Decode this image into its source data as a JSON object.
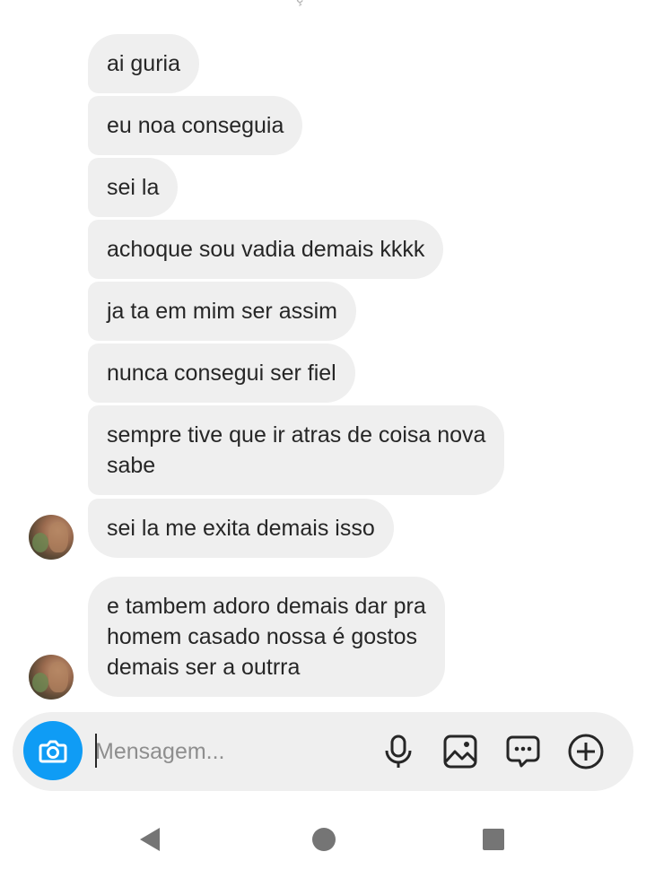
{
  "top_fragment": "ç",
  "messages": [
    {
      "text": "ai guria"
    },
    {
      "text": "eu noa conseguia"
    },
    {
      "text": "sei la"
    },
    {
      "text": "achoque sou vadia demais kkkk"
    },
    {
      "text": "ja ta em mim ser assim"
    },
    {
      "text": "nunca consegui ser fiel"
    },
    {
      "text": "sempre tive que ir atras de coisa nova\nsabe"
    },
    {
      "text": "sei la me exita demais isso"
    },
    {
      "text": "e tambem adoro demais dar pra\nhomem casado nossa é gostos\ndemais ser a outrra"
    }
  ],
  "composer": {
    "placeholder": "Mensagem...",
    "value": "",
    "icons": [
      "camera-icon",
      "microphone-icon",
      "gallery-icon",
      "sticker-icon",
      "plus-icon"
    ]
  },
  "colors": {
    "bubble": "#efefef",
    "text": "#262626",
    "accent": "#0f9cf5",
    "placeholder": "#8e8e8e"
  },
  "navbar": {
    "icons": [
      "back-icon",
      "home-icon",
      "recents-icon"
    ]
  }
}
